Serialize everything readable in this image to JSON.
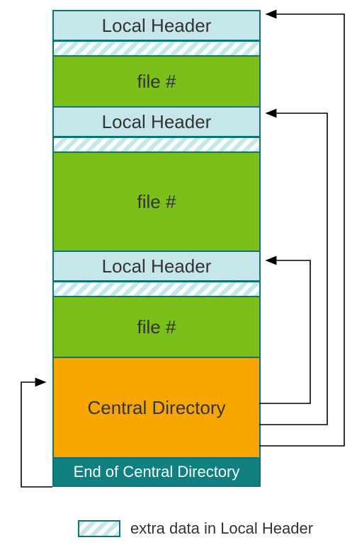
{
  "blocks": {
    "local_header_1": "Local Header",
    "file_1": "file #",
    "local_header_2": "Local Header",
    "file_2": "file #",
    "local_header_3": "Local Header",
    "file_3": "file #",
    "central_directory": "Central Directory",
    "end_of_central_directory": "End of Central Directory"
  },
  "legend": {
    "label": "extra data in Local Header"
  }
}
